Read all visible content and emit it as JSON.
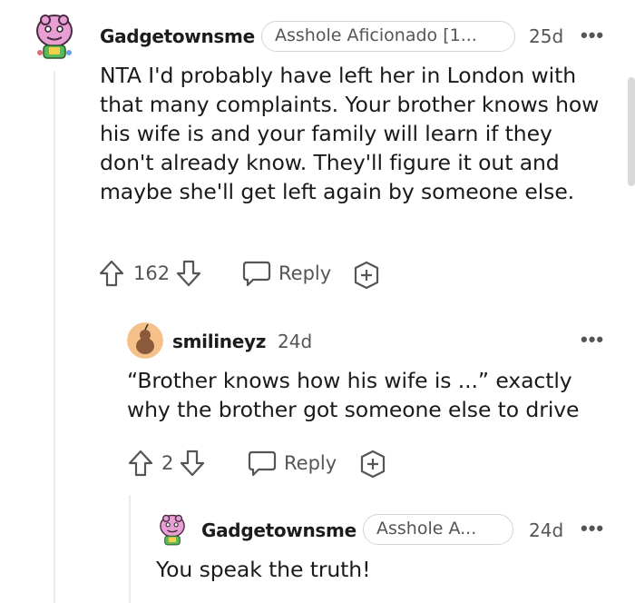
{
  "comments": [
    {
      "username": "Gadgetownsme",
      "flair": "Asshole Aficionado [1...",
      "age": "25d",
      "more": "•••",
      "body": "NTA I'd probably have left her in London with that many complaints. Your brother knows how his wife is and your family will learn if they don't already know. They'll figure it out and maybe she'll get left again by someone else.",
      "votes": "162",
      "reply_label": "Reply"
    },
    {
      "username": "smilineyz",
      "age": "24d",
      "more": "•••",
      "body": "“Brother knows how his wife is ...” exactly why the brother got someone else to drive",
      "votes": "2",
      "reply_label": "Reply"
    },
    {
      "username": "Gadgetownsme",
      "flair": "Asshole A...",
      "age": "24d",
      "more": "•••",
      "body": "You speak the truth!"
    }
  ],
  "colors": {
    "text": "#1a1a1b",
    "meta": "#555555",
    "avatar_pink": "#e8a0d4",
    "avatar_orange": "#f0a060"
  }
}
